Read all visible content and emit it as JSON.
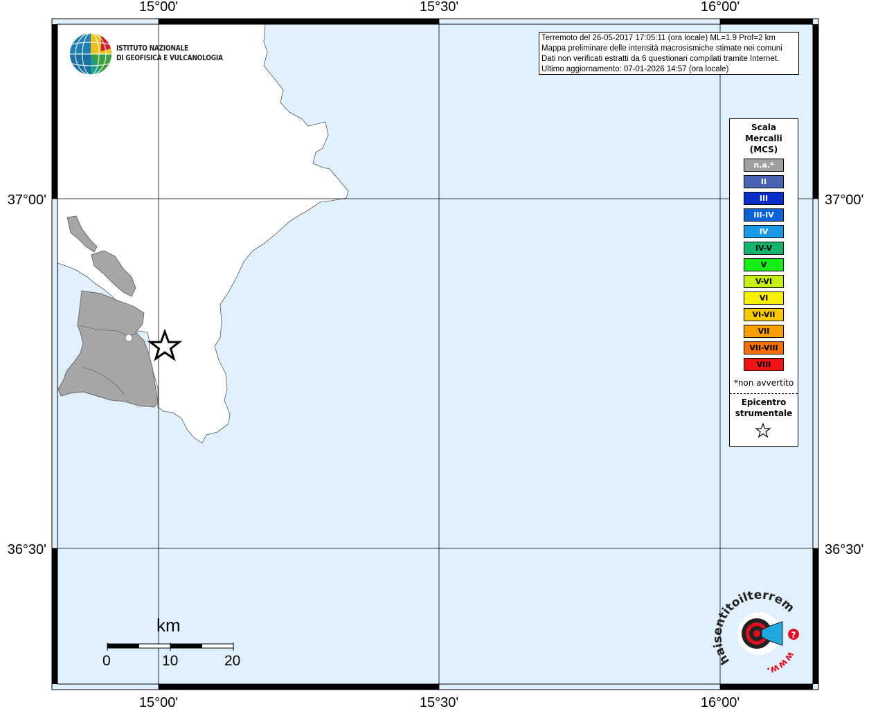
{
  "map": {
    "lat_labels": [
      "37°00'",
      "36°30'"
    ],
    "lon_labels": [
      "15°00'",
      "15°30'",
      "16°00'"
    ],
    "colors": {
      "sea": "#e0f0fc",
      "land": "#ffffff",
      "island_land": "#a6a6a6",
      "grid": "#000000",
      "frame": "#000000"
    },
    "epicenter_marker": "star-icon"
  },
  "logo": {
    "line1": "ISTITUTO NAZIONALE",
    "line2": "DI GEOFISICA E VULCANOLOGIA",
    "icon": "ingv-globe-icon"
  },
  "info": {
    "line1": "Terremoto del 26-05-2017 17:05:11 (ora locale) ML=1.9 Prof=2 km",
    "line2": "Mappa preliminare delle intensità macrosismiche stimate nei comuni",
    "line3": "Dati non verificati estratti da 6 questionari compilati tramite Internet.",
    "line4": "Ultimo aggiornamento: 07-01-2026 14:57 (ora locale)"
  },
  "legend": {
    "title1": "Scala",
    "title2": "Mercalli",
    "title3": "(MCS)",
    "items": [
      {
        "label": "n.a.*",
        "color": "#a0a0a0"
      },
      {
        "label": "II",
        "color": "#4a64b4"
      },
      {
        "label": "III",
        "color": "#0a2ec8"
      },
      {
        "label": "III-IV",
        "color": "#0a64d8"
      },
      {
        "label": "IV",
        "color": "#1a9ae6"
      },
      {
        "label": "IV-V",
        "color": "#12b46e"
      },
      {
        "label": "V",
        "color": "#14ee14"
      },
      {
        "label": "V-VI",
        "color": "#c8f014"
      },
      {
        "label": "VI",
        "color": "#f8f000"
      },
      {
        "label": "VI-VII",
        "color": "#f8c800"
      },
      {
        "label": "VII",
        "color": "#f8a000"
      },
      {
        "label": "VII-VIII",
        "color": "#f86e00"
      },
      {
        "label": "VIII",
        "color": "#f01414"
      }
    ],
    "note": "*non avvertito",
    "epicenter1": "Epicentro",
    "epicenter2": "strumentale"
  },
  "scalebar": {
    "unit": "km",
    "labels": [
      "0",
      "10",
      "20"
    ]
  },
  "badge": {
    "text_main": "haisentitoilterremoto.it",
    "text_www": "www.",
    "text_q": "?",
    "icon": "speaker-target-icon"
  }
}
